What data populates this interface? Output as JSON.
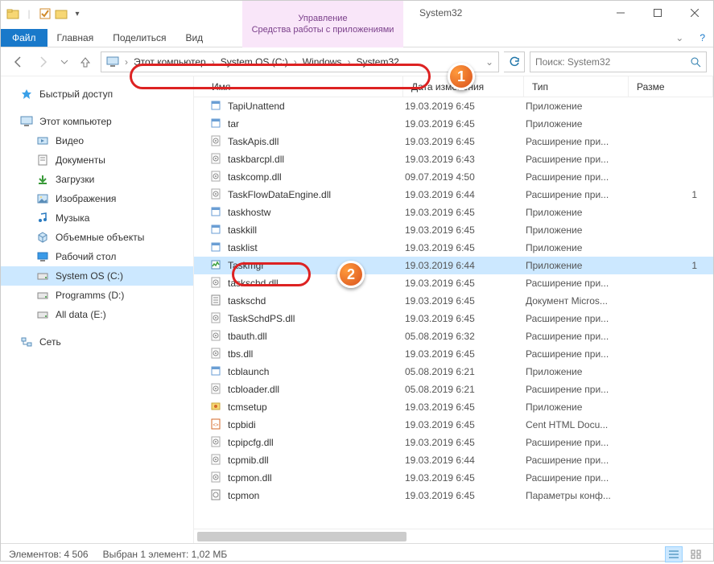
{
  "window_title": "System32",
  "contextual_tab": {
    "group": "Управление",
    "label": "Средства работы с приложениями"
  },
  "ribbon": {
    "file": "Файл",
    "tabs": [
      "Главная",
      "Поделиться",
      "Вид"
    ]
  },
  "breadcrumbs": [
    "Этот компьютер",
    "System OS (C:)",
    "Windows",
    "System32"
  ],
  "search_placeholder": "Поиск: System32",
  "nav": {
    "quick": "Быстрый доступ",
    "this_pc": "Этот компьютер",
    "children": [
      {
        "label": "Видео",
        "ico": "video"
      },
      {
        "label": "Документы",
        "ico": "doc"
      },
      {
        "label": "Загрузки",
        "ico": "down"
      },
      {
        "label": "Изображения",
        "ico": "img"
      },
      {
        "label": "Музыка",
        "ico": "music"
      },
      {
        "label": "Объемные объекты",
        "ico": "cube"
      },
      {
        "label": "Рабочий стол",
        "ico": "desk"
      },
      {
        "label": "System OS (C:)",
        "ico": "drive",
        "sel": true
      },
      {
        "label": "Programms (D:)",
        "ico": "drive"
      },
      {
        "label": "All data (E:)",
        "ico": "drive"
      }
    ],
    "network": "Сеть"
  },
  "columns": {
    "name": "Имя",
    "date": "Дата изменения",
    "type": "Тип",
    "size": "Разме"
  },
  "files": [
    {
      "name": "TapiUnattend",
      "date": "19.03.2019 6:45",
      "type": "Приложение",
      "ico": "exe",
      "size": ""
    },
    {
      "name": "tar",
      "date": "19.03.2019 6:45",
      "type": "Приложение",
      "ico": "exe",
      "size": ""
    },
    {
      "name": "TaskApis.dll",
      "date": "19.03.2019 6:45",
      "type": "Расширение при...",
      "ico": "dll",
      "size": ""
    },
    {
      "name": "taskbarcpl.dll",
      "date": "19.03.2019 6:43",
      "type": "Расширение при...",
      "ico": "dll",
      "size": ""
    },
    {
      "name": "taskcomp.dll",
      "date": "09.07.2019 4:50",
      "type": "Расширение при...",
      "ico": "dll",
      "size": ""
    },
    {
      "name": "TaskFlowDataEngine.dll",
      "date": "19.03.2019 6:44",
      "type": "Расширение при...",
      "ico": "dll",
      "size": "1"
    },
    {
      "name": "taskhostw",
      "date": "19.03.2019 6:45",
      "type": "Приложение",
      "ico": "exe",
      "size": ""
    },
    {
      "name": "taskkill",
      "date": "19.03.2019 6:45",
      "type": "Приложение",
      "ico": "exe",
      "size": ""
    },
    {
      "name": "tasklist",
      "date": "19.03.2019 6:45",
      "type": "Приложение",
      "ico": "exe",
      "size": ""
    },
    {
      "name": "Taskmgr",
      "date": "19.03.2019 6:44",
      "type": "Приложение",
      "ico": "tmgr",
      "size": "1",
      "sel": true
    },
    {
      "name": "taskschd.dll",
      "date": "19.03.2019 6:45",
      "type": "Расширение при...",
      "ico": "dll",
      "size": ""
    },
    {
      "name": "taskschd",
      "date": "19.03.2019 6:45",
      "type": "Документ Micros...",
      "ico": "doc",
      "size": ""
    },
    {
      "name": "TaskSchdPS.dll",
      "date": "19.03.2019 6:45",
      "type": "Расширение при...",
      "ico": "dll",
      "size": ""
    },
    {
      "name": "tbauth.dll",
      "date": "05.08.2019 6:32",
      "type": "Расширение при...",
      "ico": "dll",
      "size": ""
    },
    {
      "name": "tbs.dll",
      "date": "19.03.2019 6:45",
      "type": "Расширение при...",
      "ico": "dll",
      "size": ""
    },
    {
      "name": "tcblaunch",
      "date": "05.08.2019 6:21",
      "type": "Приложение",
      "ico": "exe",
      "size": ""
    },
    {
      "name": "tcbloader.dll",
      "date": "05.08.2019 6:21",
      "type": "Расширение при...",
      "ico": "dll",
      "size": ""
    },
    {
      "name": "tcmsetup",
      "date": "19.03.2019 6:45",
      "type": "Приложение",
      "ico": "tcm",
      "size": ""
    },
    {
      "name": "tcpbidi",
      "date": "19.03.2019 6:45",
      "type": "Cent HTML Docu...",
      "ico": "html",
      "size": ""
    },
    {
      "name": "tcpipcfg.dll",
      "date": "19.03.2019 6:45",
      "type": "Расширение при...",
      "ico": "dll",
      "size": ""
    },
    {
      "name": "tcpmib.dll",
      "date": "19.03.2019 6:44",
      "type": "Расширение при...",
      "ico": "dll",
      "size": ""
    },
    {
      "name": "tcpmon.dll",
      "date": "19.03.2019 6:45",
      "type": "Расширение при...",
      "ico": "dll",
      "size": ""
    },
    {
      "name": "tcpmon",
      "date": "19.03.2019 6:45",
      "type": "Параметры конф...",
      "ico": "ini",
      "size": ""
    }
  ],
  "status": {
    "count_label": "Элементов: 4 506",
    "sel_label": "Выбран 1 элемент: 1,02 МБ"
  },
  "callouts": {
    "one": "1",
    "two": "2"
  }
}
